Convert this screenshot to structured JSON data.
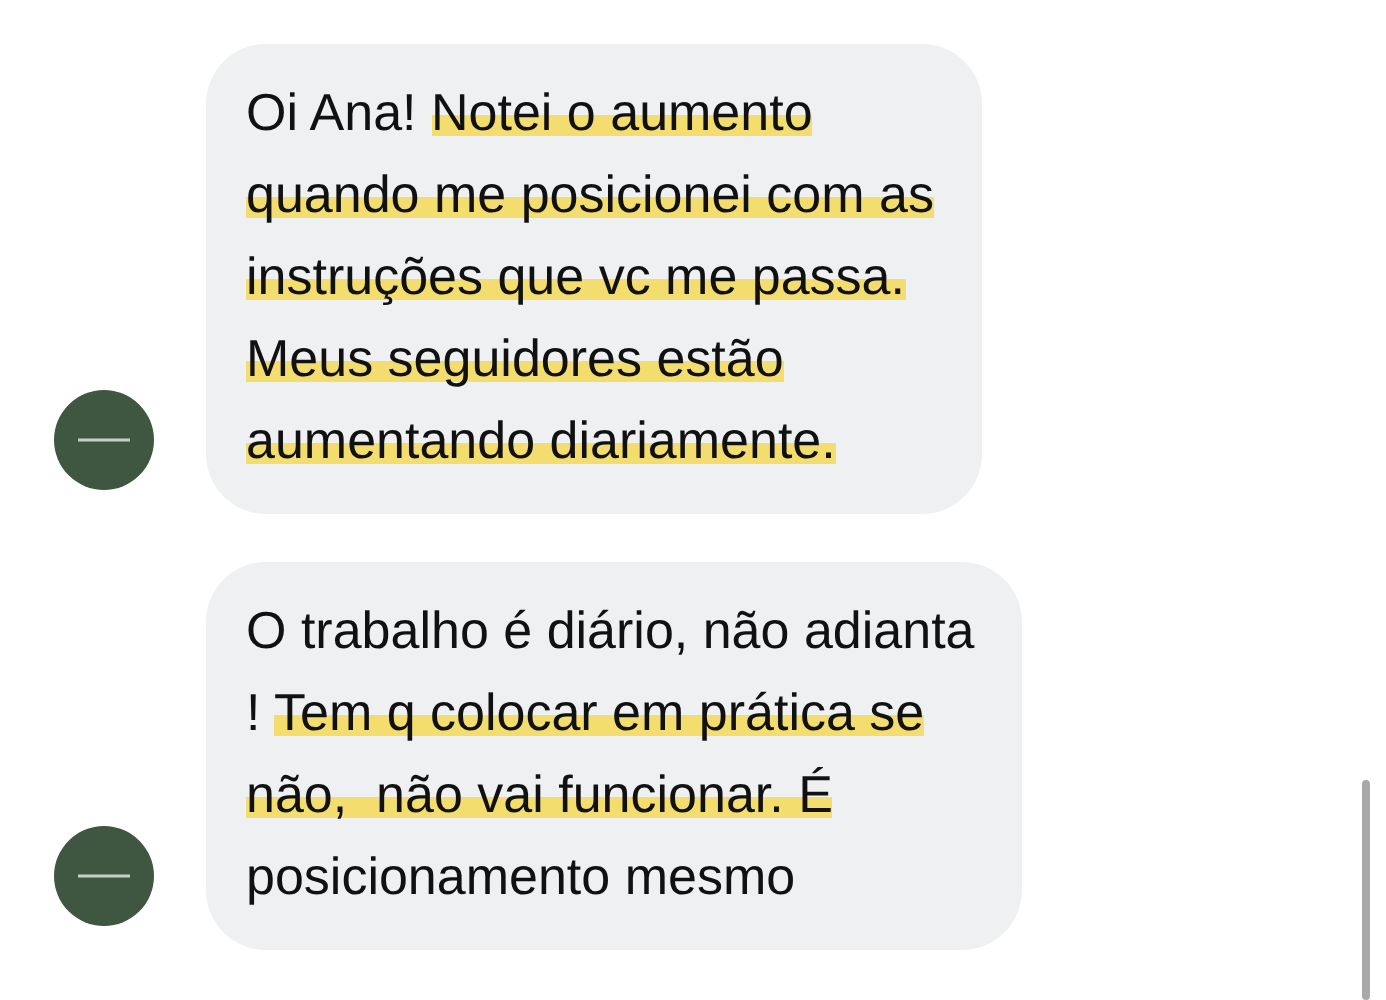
{
  "messages": [
    {
      "lines": [
        [
          {
            "text": "Oi Ana! ",
            "highlighted": false
          },
          {
            "text": "Notei o aumento",
            "highlighted": true
          }
        ],
        [
          {
            "text": "quando me posicionei com as",
            "highlighted": true
          }
        ],
        [
          {
            "text": "instruções que vc me passa.",
            "highlighted": true
          }
        ],
        [
          {
            "text": "Meus seguidores estão",
            "highlighted": true
          }
        ],
        [
          {
            "text": "aumentando diariamente.",
            "highlighted": true
          }
        ]
      ]
    },
    {
      "lines": [
        [
          {
            "text": "O trabalho é diário, não adianta",
            "highlighted": false
          }
        ],
        [
          {
            "text": "! ",
            "highlighted": false
          },
          {
            "text": "Tem q colocar em prática se",
            "highlighted": true
          }
        ],
        [
          {
            "text": "não,  não vai funcionar. É",
            "highlighted": true
          }
        ],
        [
          {
            "text": "posicionamento mesmo",
            "highlighted": false
          }
        ]
      ]
    }
  ]
}
